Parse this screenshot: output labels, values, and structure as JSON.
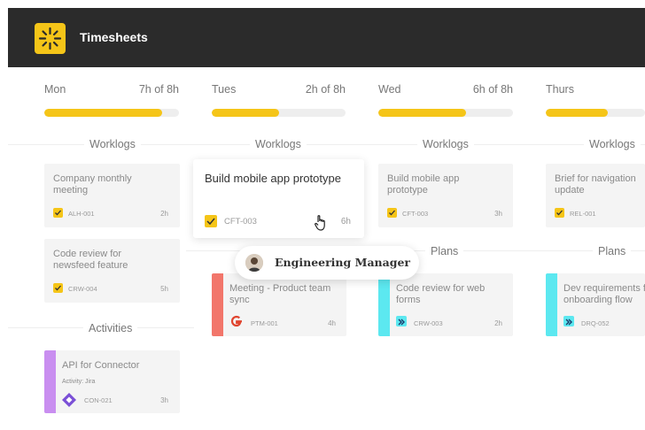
{
  "app": {
    "title": "Timesheets",
    "logo_icon": "sunburst-icon",
    "accent_color": "#f5c518"
  },
  "days": [
    {
      "name": "Mon",
      "hours": "7h of 8h",
      "progress": 0.875
    },
    {
      "name": "Tues",
      "hours": "2h of 8h",
      "progress": 0.5
    },
    {
      "name": "Wed",
      "hours": "6h of 8h",
      "progress": 0.65
    },
    {
      "name": "Thurs",
      "hours": "",
      "progress": 0.625
    }
  ],
  "sections": {
    "worklogs": "Worklogs",
    "activities": "Activities",
    "plans": "Plans"
  },
  "worklogs": {
    "mon_1": {
      "title": "Company monthly meeting",
      "code": "ALH-001",
      "hours": "2h"
    },
    "mon_2": {
      "title": "Code review for newsfeed feature",
      "code": "CRW-004",
      "hours": "5h"
    },
    "tue_1": {
      "title": "Build mobile app prototype",
      "code": "CFT-003",
      "hours": "6h"
    },
    "wed_1": {
      "title": "Build mobile app prototype",
      "code": "CFT-003",
      "hours": "3h"
    },
    "thu_1": {
      "title": "Brief for navigation update",
      "code": "REL-001",
      "hours": ""
    }
  },
  "activities": {
    "mon_1": {
      "title": "API for Connector",
      "sub": "Activity: Jira",
      "code": "CON-021",
      "hours": "3h",
      "color": "#c98ef0"
    }
  },
  "plans": {
    "tue_1": {
      "title": "Meeting - Product team sync",
      "code": "PTM-001",
      "hours": "4h",
      "color": "#f2766b",
      "icon": "google-icon"
    },
    "wed_1": {
      "title": "Code review for web forms",
      "code": "CRW-003",
      "hours": "2h",
      "color": "#5ce8f0",
      "icon": "double-chevron-icon"
    },
    "thu_1": {
      "title": "Dev requirements for onboarding flow",
      "code": "DRQ-052",
      "hours": "",
      "color": "#5ce8f0",
      "icon": "double-chevron-icon"
    }
  },
  "role_chip": {
    "label": "Engineering Manager"
  }
}
